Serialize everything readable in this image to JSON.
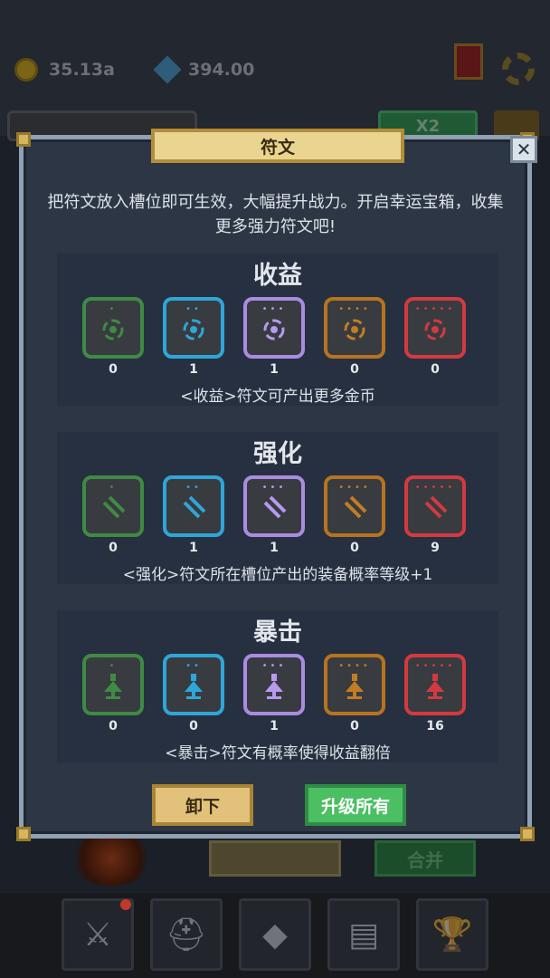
{
  "hud": {
    "gold": "35.13a",
    "gems": "394.00",
    "icons": [
      "coin-icon",
      "gem-icon",
      "spellbook-icon",
      "settings-gear-icon"
    ]
  },
  "background": {
    "multiplier_label": "X2",
    "green_button_label": "合并",
    "nav": [
      {
        "name": "sword",
        "glyph": "⚔",
        "has_badge": true
      },
      {
        "name": "armor",
        "glyph": "⛑",
        "has_badge": false
      },
      {
        "name": "gem",
        "glyph": "◆",
        "has_badge": false
      },
      {
        "name": "chest",
        "glyph": "▤",
        "has_badge": false
      },
      {
        "name": "trophy",
        "glyph": "🏆",
        "has_badge": false
      }
    ]
  },
  "dialog": {
    "title": "符文",
    "close_label": "✕",
    "intro": "把符文放入槽位即可生效，大幅提升战力。开启幸运宝箱，收集更多强力符文吧!",
    "sections": [
      {
        "title": "收益",
        "glyph": "income",
        "description": "<收益>符文可产出更多金币",
        "counts": [
          "0",
          "1",
          "1",
          "0",
          "0"
        ]
      },
      {
        "title": "强化",
        "glyph": "enhance",
        "description": "<强化>符文所在槽位产出的装备概率等级+1",
        "counts": [
          "0",
          "1",
          "1",
          "0",
          "9"
        ]
      },
      {
        "title": "暴击",
        "glyph": "crit",
        "description": "<暴击>符文有概率使得收益翻倍",
        "counts": [
          "0",
          "0",
          "1",
          "0",
          "16"
        ]
      }
    ],
    "tiers": [
      {
        "name": "green",
        "border": "#3f8a44",
        "glyph": "#3f8a44",
        "dots": 1
      },
      {
        "name": "blue",
        "border": "#2fa6d8",
        "glyph": "#2fa6d8",
        "dots": 2
      },
      {
        "name": "purple",
        "border": "#a98ce0",
        "glyph": "#b79af0",
        "dots": 3
      },
      {
        "name": "orange",
        "border": "#b7731f",
        "glyph": "#c27d22",
        "dots": 4
      },
      {
        "name": "red",
        "border": "#d23a40",
        "glyph": "#d23a40",
        "dots": 5
      }
    ],
    "buttons": {
      "unload": "卸下",
      "upgrade_all": "升级所有"
    }
  }
}
